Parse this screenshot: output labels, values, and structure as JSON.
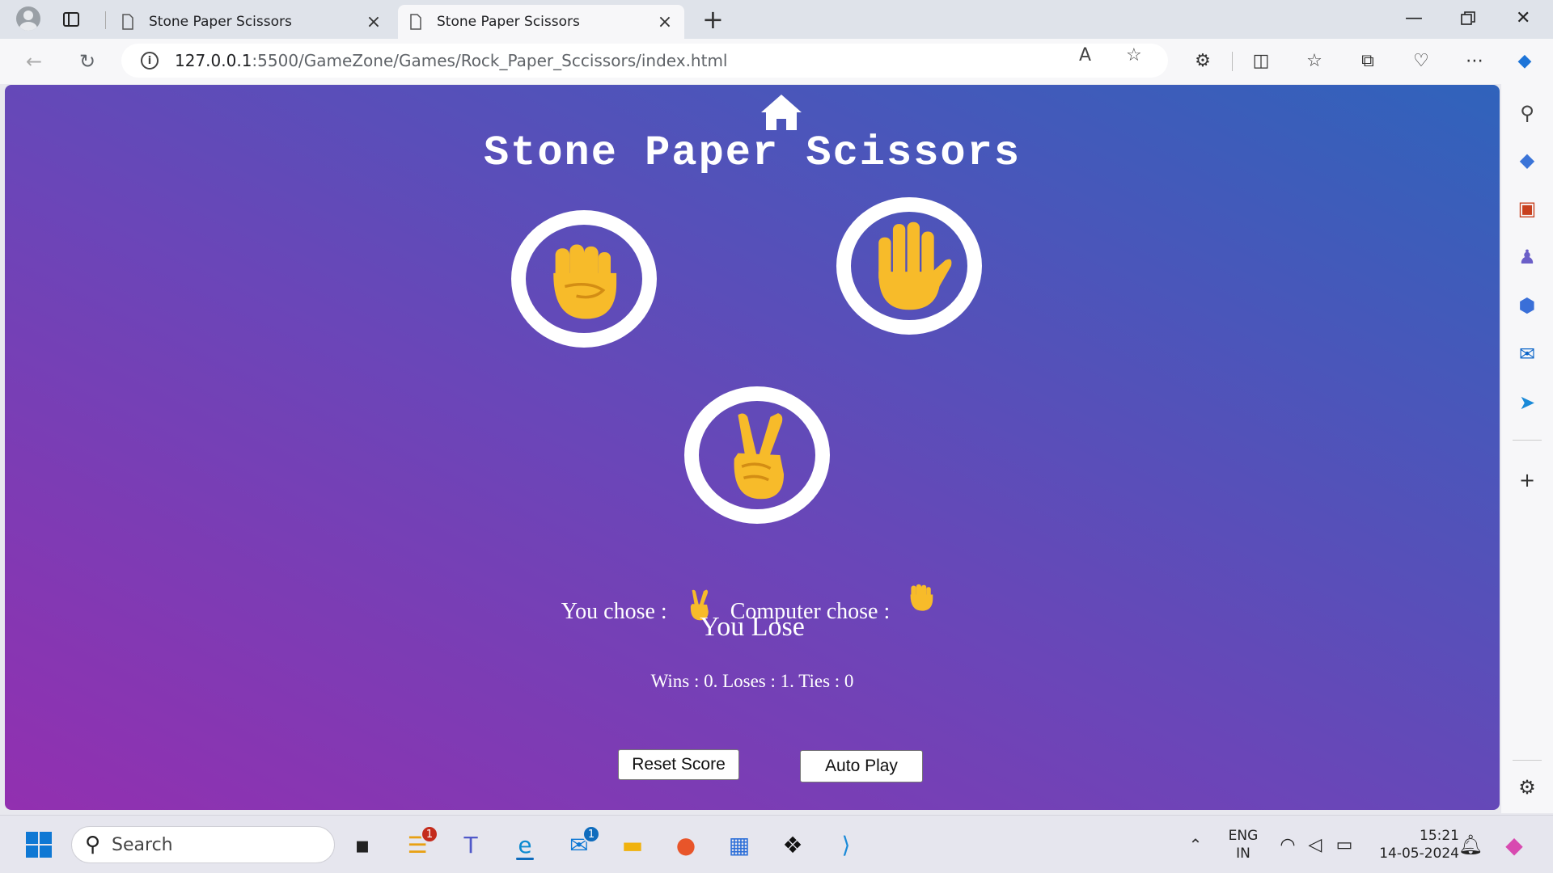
{
  "browser": {
    "tabs": [
      {
        "title": "Stone Paper Scissors",
        "active": false
      },
      {
        "title": "Stone Paper Scissors",
        "active": true
      }
    ],
    "address": {
      "host": "127.0.0.1",
      "path": ":5500/GameZone/Games/Rock_Paper_Sccissors/index.html"
    }
  },
  "game": {
    "title": "Stone Paper Scissors",
    "choices": [
      "rock-fist",
      "paper-hand",
      "scissors-victory-hand"
    ],
    "you_chose_label": "You chose :",
    "computer_chose_label": "Computer chose :",
    "you_chose": "scissors",
    "computer_chose": "rock",
    "outcome": "You Lose",
    "score_text": "Wins : 0. Loses : 1. Ties : 0",
    "reset_label": "Reset Score",
    "autoplay_label": "Auto Play"
  },
  "taskbar": {
    "search_placeholder": "Search",
    "badges": {
      "notes": "1",
      "mail": "1"
    },
    "lang_top": "ENG",
    "lang_bottom": "IN",
    "time": "15:21",
    "date": "14-05-2024"
  },
  "colors": {
    "gradient_start": "#9230b0",
    "gradient_end": "#3063bb",
    "hand": "#f7bb2a"
  }
}
